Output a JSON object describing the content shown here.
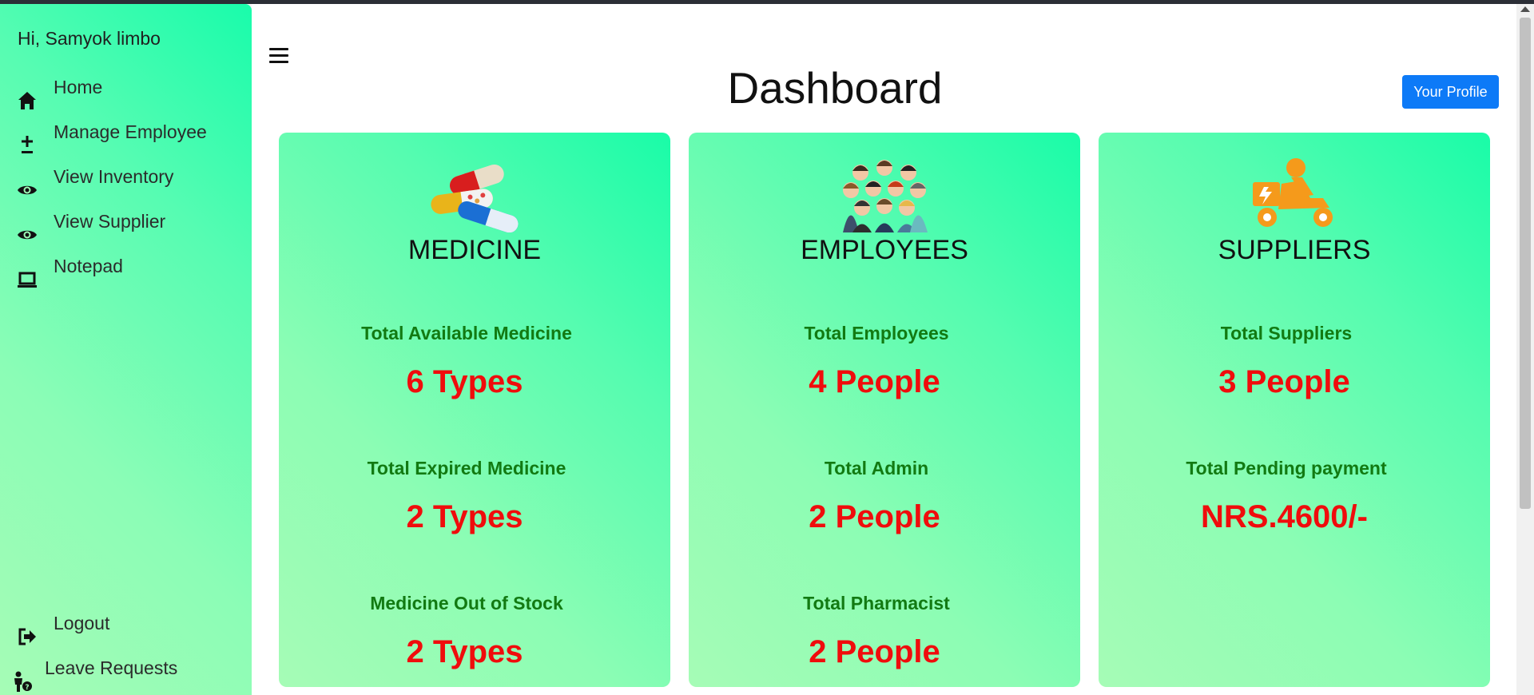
{
  "sidebar": {
    "greeting": "Hi, Samyok limbo",
    "items": [
      {
        "label": "Home",
        "icon": "home-icon"
      },
      {
        "label": "Manage Employee",
        "icon": "plus-minus-icon"
      },
      {
        "label": "View Inventory",
        "icon": "eye-icon"
      },
      {
        "label": "View Supplier",
        "icon": "eye-icon"
      },
      {
        "label": "Notepad",
        "icon": "laptop-icon"
      }
    ],
    "bottom_items": [
      {
        "label": "Logout",
        "icon": "logout-icon"
      },
      {
        "label": "Leave Requests",
        "icon": "person-question-icon"
      }
    ]
  },
  "header": {
    "title": "Dashboard",
    "profile_button": "Your Profile"
  },
  "cards": [
    {
      "title": "MEDICINE",
      "icon": "pills-icon",
      "stats": [
        {
          "label": "Total Available Medicine",
          "value": "6 Types"
        },
        {
          "label": "Total Expired Medicine",
          "value": "2 Types"
        },
        {
          "label": "Medicine Out of Stock",
          "value": "2 Types"
        }
      ]
    },
    {
      "title": "EMPLOYEES",
      "icon": "people-group-icon",
      "stats": [
        {
          "label": "Total Employees",
          "value": "4 People"
        },
        {
          "label": "Total Admin",
          "value": "2 People"
        },
        {
          "label": "Total Pharmacist",
          "value": "2 People"
        }
      ]
    },
    {
      "title": "SUPPLIERS",
      "icon": "delivery-scooter-icon",
      "stats": [
        {
          "label": "Total Suppliers",
          "value": "3 People"
        },
        {
          "label": "Total Pending payment",
          "value": "NRS.4600/-"
        }
      ]
    }
  ],
  "colors": {
    "accent": "#19fcab",
    "stat_label": "#127a12",
    "stat_value": "#f00c0c",
    "button": "#0d7af7"
  }
}
